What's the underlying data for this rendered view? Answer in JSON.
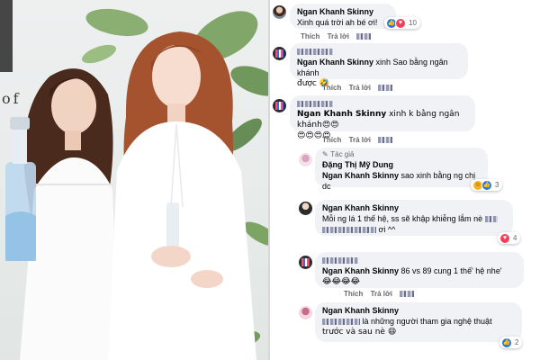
{
  "photo": {
    "brand_text": "of"
  },
  "actions": {
    "like": "Thích",
    "reply": "Trả lời"
  },
  "comments": [
    {
      "author": "Ngan Khanh Skinny",
      "text": "Xinh quá trời ah bé ơi!",
      "reaction_count": "10"
    },
    {
      "mention": "Ngan Khanh Skinny",
      "text_a": " xinh Sao bằng ngân khánh",
      "text_b": "được 🤣"
    },
    {
      "mention": "Ngan Khanh Skinny",
      "text_a": " xinh k bằng ngân khánh😍😍",
      "text_b": "😍😍😍😍"
    },
    {
      "author_tag": "Tác giả",
      "author": "Đặng Thị Mỹ Dung",
      "mention": "Ngan Khanh Skinny",
      "text_a": " sao xinh bằng ng chị dc",
      "reaction_count": "3"
    },
    {
      "author": "Ngan Khanh Skinny",
      "text_a": "Mỗi ng lá 1 thế hệ, ss sẽ khập khiễng lắm nè",
      "text_b": "ơi ^^",
      "reaction_count": "4"
    },
    {
      "mention": "Ngan Khanh Skinny",
      "text_a": " 86 vs 89 cung 1 thế' hệ nhe'",
      "text_b": "😂😂😂😂"
    },
    {
      "author": "Ngan Khanh Skinny",
      "text_a": "là những người tham gia nghệ thuật",
      "text_b": "trước và sau nè 😄",
      "reaction_count": "2"
    }
  ]
}
